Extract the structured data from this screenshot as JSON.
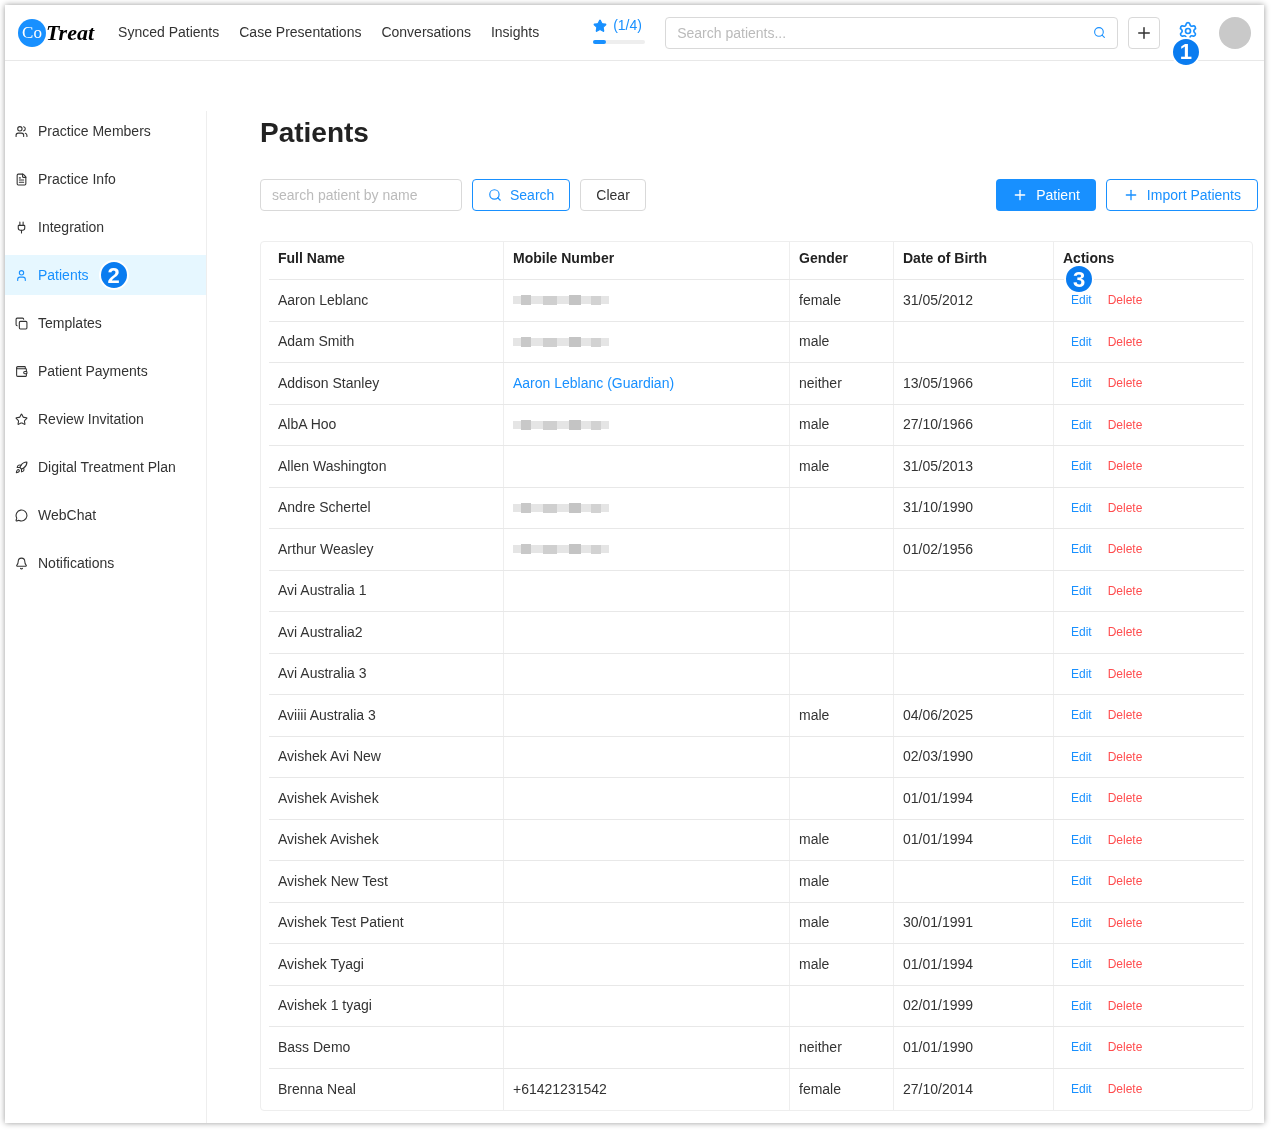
{
  "header": {
    "logo": {
      "mark": "Co",
      "word": "Treat"
    },
    "nav": [
      {
        "label": "Synced Patients"
      },
      {
        "label": "Case Presentations"
      },
      {
        "label": "Conversations"
      },
      {
        "label": "Insights"
      }
    ],
    "progress": {
      "text": "(1/4)",
      "level": 0.25
    },
    "search": {
      "placeholder": "Search patients..."
    },
    "settings_callout": "1"
  },
  "sidebar": {
    "items": [
      {
        "label": "Practice Members",
        "selected": false
      },
      {
        "label": "Practice Info",
        "selected": false
      },
      {
        "label": "Integration",
        "selected": false
      },
      {
        "label": "Patients",
        "selected": true,
        "callout": "2"
      },
      {
        "label": "Templates",
        "selected": false
      },
      {
        "label": "Patient Payments",
        "selected": false
      },
      {
        "label": "Review Invitation",
        "selected": false
      },
      {
        "label": "Digital Treatment Plan",
        "selected": false
      },
      {
        "label": "WebChat",
        "selected": false
      },
      {
        "label": "Notifications",
        "selected": false
      }
    ]
  },
  "page": {
    "title": "Patients",
    "filter": {
      "placeholder": "search patient by name",
      "search_button": "Search",
      "clear_button": "Clear"
    },
    "add_button": "Patient",
    "import_button": "Import Patients"
  },
  "table": {
    "columns": [
      "Full Name",
      "Mobile Number",
      "Gender",
      "Date of Birth",
      "Actions"
    ],
    "actions_callout": "3",
    "rows": [
      {
        "name": "Aaron Leblanc",
        "mobile": {
          "kind": "redacted"
        },
        "gender": "female",
        "dob": "31/05/2012",
        "edit": "Edit",
        "delete": "Delete"
      },
      {
        "name": "Adam Smith",
        "mobile": {
          "kind": "redacted"
        },
        "gender": "male",
        "edit": "Edit",
        "delete": "Delete"
      },
      {
        "name": "Addison Stanley",
        "mobile": {
          "kind": "link",
          "text": "Aaron Leblanc (Guardian)"
        },
        "gender": "neither",
        "dob": "13/05/1966",
        "edit": "Edit",
        "delete": "Delete"
      },
      {
        "name": "AlbA Hoo",
        "mobile": {
          "kind": "redacted"
        },
        "gender": "male",
        "dob": "27/10/1966",
        "edit": "Edit",
        "delete": "Delete"
      },
      {
        "name": "Allen Washington",
        "gender": "male",
        "dob": "31/05/2013",
        "edit": "Edit",
        "delete": "Delete"
      },
      {
        "name": "Andre Schertel",
        "mobile": {
          "kind": "redacted"
        },
        "dob": "31/10/1990",
        "edit": "Edit",
        "delete": "Delete"
      },
      {
        "name": "Arthur Weasley",
        "mobile": {
          "kind": "redacted"
        },
        "dob": "01/02/1956",
        "edit": "Edit",
        "delete": "Delete"
      },
      {
        "name": "Avi Australia 1",
        "edit": "Edit",
        "delete": "Delete"
      },
      {
        "name": "Avi Australia2",
        "edit": "Edit",
        "delete": "Delete"
      },
      {
        "name": "Avi Australia 3",
        "edit": "Edit",
        "delete": "Delete"
      },
      {
        "name": "Aviiii Australia 3",
        "gender": "male",
        "dob": "04/06/2025",
        "edit": "Edit",
        "delete": "Delete"
      },
      {
        "name": "Avishek Avi New",
        "dob": "02/03/1990",
        "edit": "Edit",
        "delete": "Delete"
      },
      {
        "name": "Avishek Avishek",
        "dob": "01/01/1994",
        "edit": "Edit",
        "delete": "Delete"
      },
      {
        "name": "Avishek Avishek",
        "gender": "male",
        "dob": "01/01/1994",
        "edit": "Edit",
        "delete": "Delete"
      },
      {
        "name": "Avishek New Test",
        "gender": "male",
        "edit": "Edit",
        "delete": "Delete"
      },
      {
        "name": "Avishek Test Patient",
        "gender": "male",
        "dob": "30/01/1991",
        "edit": "Edit",
        "delete": "Delete"
      },
      {
        "name": "Avishek Tyagi",
        "gender": "male",
        "dob": "01/01/1994",
        "edit": "Edit",
        "delete": "Delete"
      },
      {
        "name": "Avishek 1 tyagi",
        "dob": "02/01/1999",
        "edit": "Edit",
        "delete": "Delete"
      },
      {
        "name": "Bass Demo",
        "gender": "neither",
        "dob": "01/01/1990",
        "edit": "Edit",
        "delete": "Delete"
      },
      {
        "name": "Brenna Neal",
        "mobile": {
          "kind": "text",
          "text": "+61421231542"
        },
        "gender": "female",
        "dob": "27/10/2014",
        "edit": "Edit",
        "delete": "Delete"
      }
    ]
  }
}
